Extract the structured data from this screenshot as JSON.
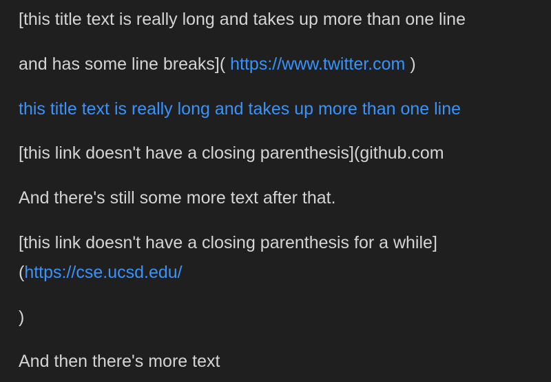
{
  "paragraph1": {
    "line1": "[this title text is really long and takes up more than one line",
    "line2_text": "and has some line breaks](",
    "line2_link": "https://www.twitter.com",
    "line2_close": ")"
  },
  "paragraph2": {
    "link_text": "this title text is really long and takes up more than one line"
  },
  "paragraph3": {
    "line1": "[this link doesn't have a closing parenthesis](github.com",
    "line2": "And there's still some more text after that."
  },
  "paragraph4": {
    "line1": "[this link doesn't have a closing parenthesis for a while]",
    "line2_open": "(",
    "line2_link": "https://cse.ucsd.edu/",
    "close_paren": ")"
  },
  "paragraph5": {
    "text": "And then there's more text"
  },
  "colors": {
    "background": "#1f1f1f",
    "text": "#d4d4d4",
    "link": "#3794ff"
  }
}
